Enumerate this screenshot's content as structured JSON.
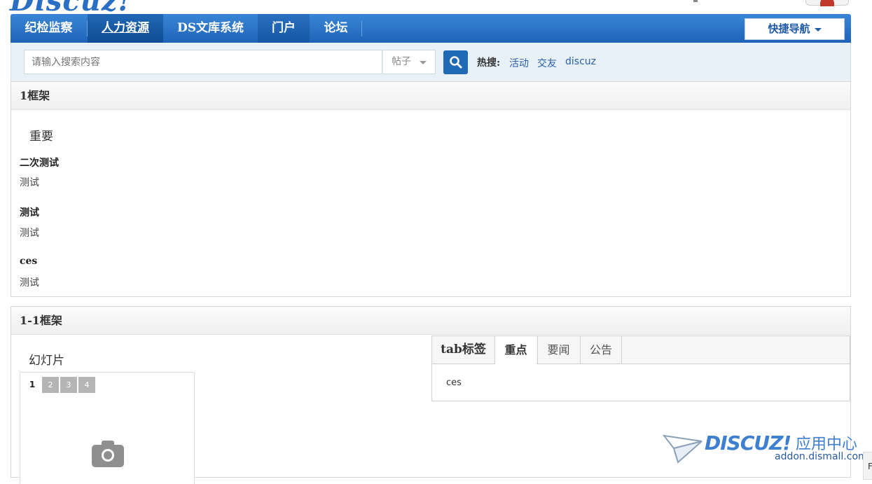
{
  "header": {
    "logo_text": "Discuz!"
  },
  "nav": {
    "items": [
      {
        "label": "纪检监察"
      },
      {
        "label": "人力资源"
      },
      {
        "label": "DS文库系统"
      },
      {
        "label": "门户"
      },
      {
        "label": "论坛"
      }
    ],
    "quick_nav_label": "快捷导航"
  },
  "search": {
    "placeholder": "请输入搜索内容",
    "type_selected": "帖子",
    "hot_label": "热搜:",
    "hot_terms": [
      "活动",
      "交友",
      "discuz"
    ]
  },
  "frame1": {
    "title": "1框架",
    "block_title": "重要",
    "articles": [
      {
        "title": "二次测试",
        "body": "测试"
      },
      {
        "title": "测试",
        "body": "测试"
      },
      {
        "title": "ces",
        "body": "测试"
      }
    ]
  },
  "frame2": {
    "title": "1-1框架",
    "slideshow_title": "幻灯片",
    "slide_numbers": [
      "1",
      "2",
      "3",
      "4"
    ],
    "tab_caption": "tab标签",
    "tabs": [
      "重点",
      "要闻",
      "公告"
    ],
    "tab_content": "ces"
  },
  "watermark": {
    "brand": "DISCUZ!",
    "cn": "应用中心",
    "url": "addon.dismall.com"
  },
  "corner": {
    "char": "F"
  },
  "colors": {
    "nav_blue": "#1f63b8",
    "link_blue": "#2a5fa8",
    "search_bg": "#e8f0f8"
  }
}
